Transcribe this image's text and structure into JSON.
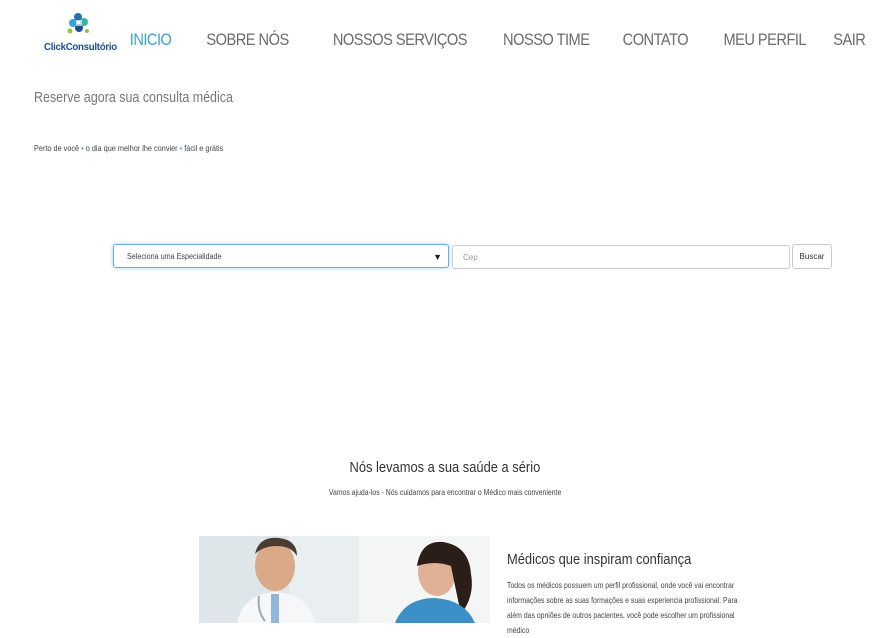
{
  "header": {
    "logo_text": "ClickConsultório",
    "nav": [
      {
        "label": "INICIO",
        "active": true
      },
      {
        "label": "SOBRE NÓS",
        "active": false
      },
      {
        "label": "NOSSOS SERVIÇOS",
        "active": false
      },
      {
        "label": "NOSSO TIME",
        "active": false
      },
      {
        "label": "CONTATO",
        "active": false
      },
      {
        "label": "MEU PERFIL",
        "active": false
      },
      {
        "label": "SAIR",
        "active": false
      }
    ]
  },
  "hero": {
    "title": "Reserve agora sua consulta médica",
    "sub_parts": [
      "Perto de você",
      "o dia que melhor lhe convier",
      "fácil e grátis"
    ],
    "separator": "•"
  },
  "search": {
    "specialty_value": "Seleciona uma Especialidade",
    "cep_placeholder": "Cep",
    "button_label": "Buscar"
  },
  "section": {
    "title": "Nós levamos a sua saúde a sério",
    "subtitle": "Vamos ajuda-los - Nós cuidamos para encontrar o Médico mais conveniente"
  },
  "feature": {
    "title": "Médicos que inspiram confiança",
    "body": "Todos os médicos possuem um perfil profissional, onde você vai encontrar informações sobre as suas formações e suas experiencia profissional. Para além das opniões de outros pacientes, você pode escolher um profissional médico"
  },
  "colors": {
    "accent": "#3aa0d6",
    "nav_text": "#6b6b6b",
    "logo_text": "#1f4e8c"
  }
}
